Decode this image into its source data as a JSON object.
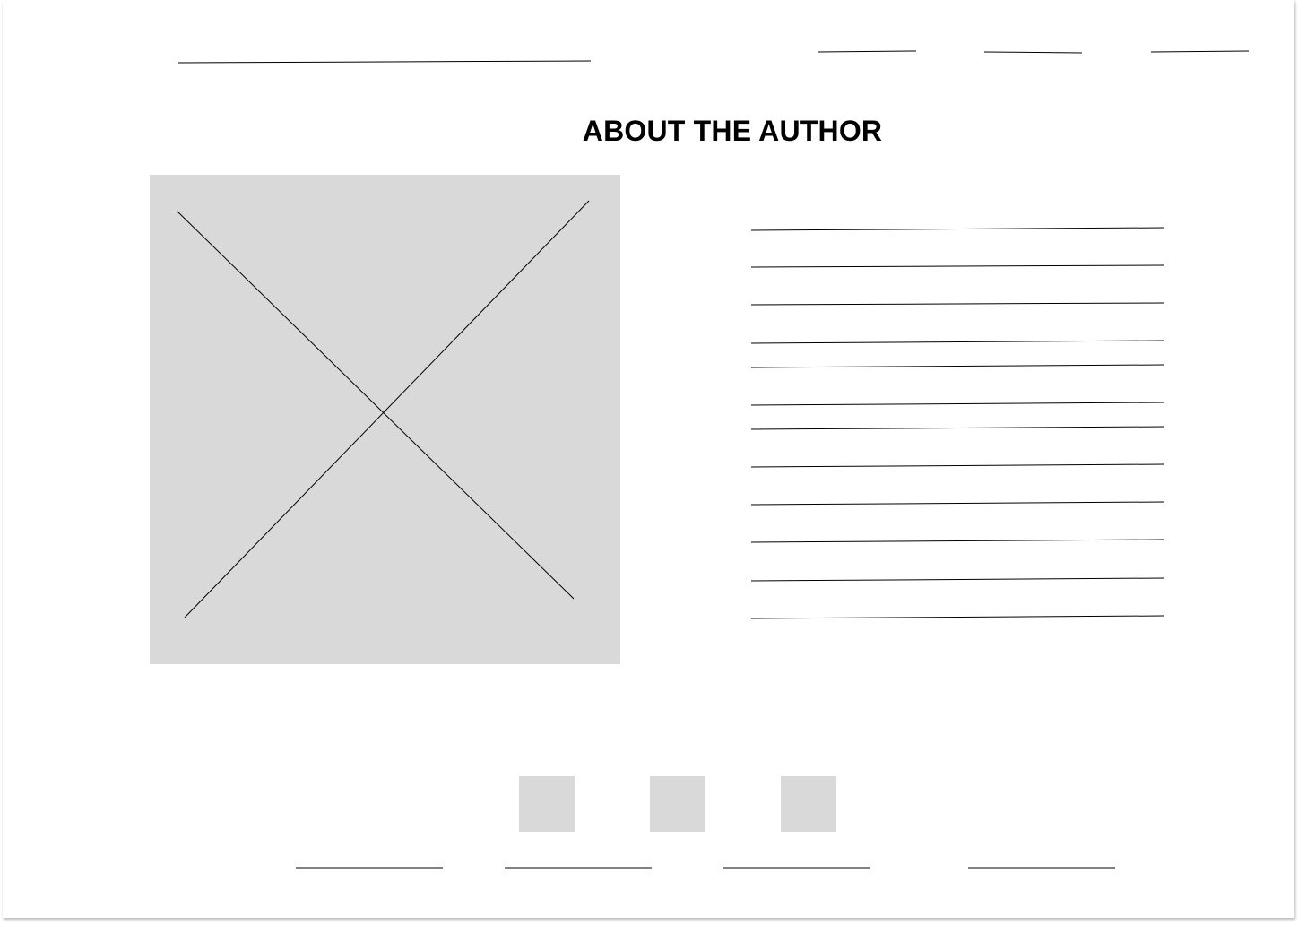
{
  "header": {
    "heading": "ABOUT THE AUTHOR"
  },
  "nav": {
    "logo_line": "placeholder-line",
    "items": [
      "nav-link-1",
      "nav-link-2",
      "nav-link-3"
    ]
  },
  "author": {
    "photo": "image-placeholder",
    "bio_lines": 12
  },
  "social": {
    "icons": [
      "social-icon-1",
      "social-icon-2",
      "social-icon-3"
    ]
  },
  "footer": {
    "links": 4
  },
  "colors": {
    "placeholder_fill": "#d9d9d9",
    "line": "#000000",
    "background": "#ffffff"
  }
}
